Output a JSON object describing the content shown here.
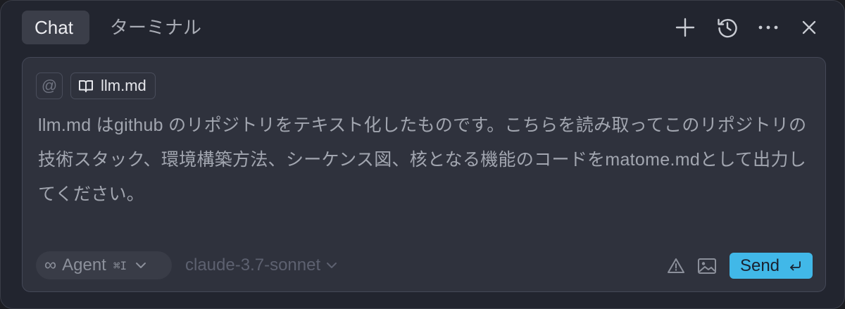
{
  "header": {
    "tabs": [
      {
        "label": "Chat",
        "active": true
      },
      {
        "label": "ターミナル",
        "active": false
      }
    ],
    "actions": [
      "plus-icon",
      "history-icon",
      "more-icon",
      "close-icon"
    ]
  },
  "composer": {
    "at_symbol": "@",
    "attached_file": {
      "icon": "book-icon",
      "name": "llm.md"
    },
    "prompt_text": "llm.md はgithub のリポジトリをテキスト化したものです。こちらを読み取ってこのリポジトリの技術スタック、環境構築方法、シーケンス図、核となる機能のコードをmatome.mdとして出力してください。",
    "mode": {
      "icon": "infinity-icon",
      "symbol": "∞",
      "label": "Agent",
      "shortcut": "⌘I"
    },
    "model": "claude-3.7-sonnet",
    "send": {
      "label": "Send"
    }
  },
  "colors": {
    "background": "#22252f",
    "composer": "#2f323d",
    "accent": "#41b8e8"
  }
}
